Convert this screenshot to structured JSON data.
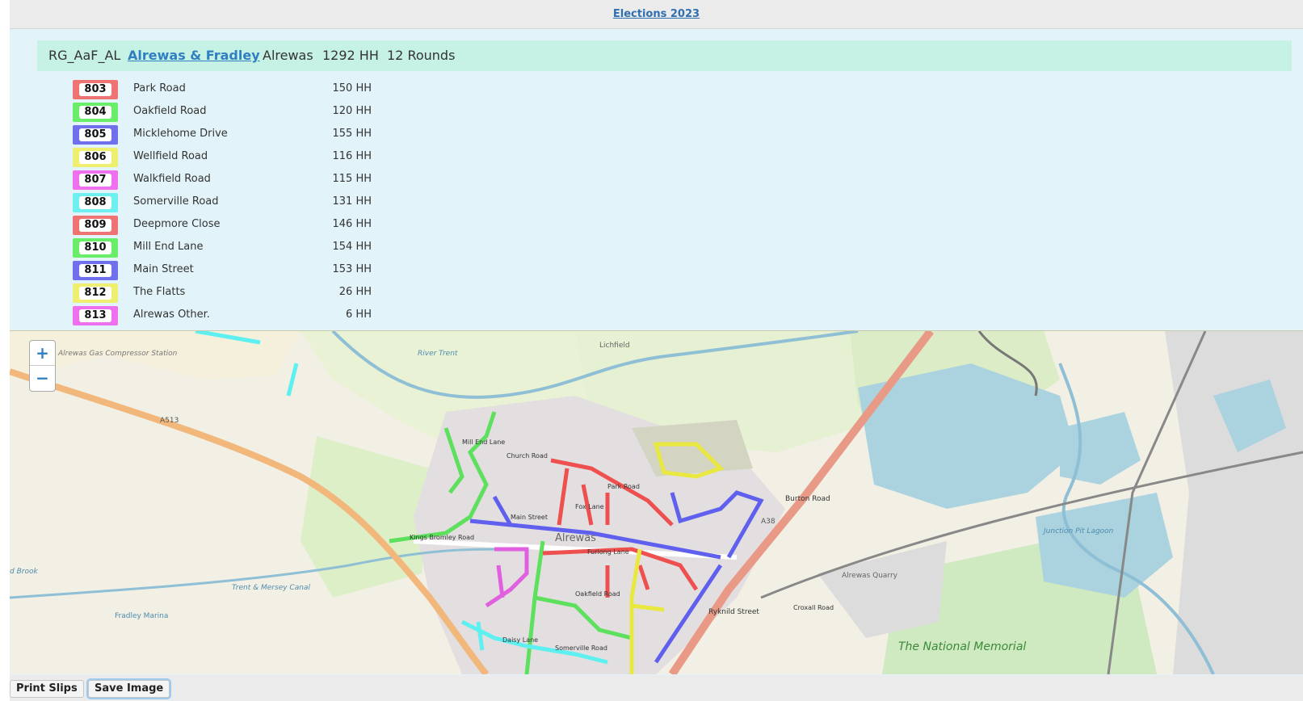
{
  "app": {
    "title_link": "Elections 2023"
  },
  "header": {
    "code": "RG_AaF_AL",
    "ward_link": "Alrewas & Fradley",
    "place": "Alrewas",
    "households": "1292 HH",
    "rounds": "12 Rounds"
  },
  "rounds": [
    {
      "number": "803",
      "street": "Park Road",
      "hh": "150 HH",
      "color": "#f07373"
    },
    {
      "number": "804",
      "street": "Oakfield Road",
      "hh": "120 HH",
      "color": "#6aee6a"
    },
    {
      "number": "805",
      "street": "Micklehome Drive",
      "hh": "155 HH",
      "color": "#7070ee"
    },
    {
      "number": "806",
      "street": "Wellfield Road",
      "hh": "116 HH",
      "color": "#efef6f"
    },
    {
      "number": "807",
      "street": "Walkfield Road",
      "hh": "115 HH",
      "color": "#ee70ee"
    },
    {
      "number": "808",
      "street": "Somerville Road",
      "hh": "131 HH",
      "color": "#6ff0f0"
    },
    {
      "number": "809",
      "street": "Deepmore Close",
      "hh": "146 HH",
      "color": "#f07373"
    },
    {
      "number": "810",
      "street": "Mill End Lane",
      "hh": "154 HH",
      "color": "#6aee6a"
    },
    {
      "number": "811",
      "street": "Main Street",
      "hh": "153 HH",
      "color": "#7070ee"
    },
    {
      "number": "812",
      "street": "The Flatts",
      "hh": "26 HH",
      "color": "#efef6f"
    },
    {
      "number": "813",
      "street": "Alrewas Other.",
      "hh": "6 HH",
      "color": "#ee70ee"
    }
  ],
  "map": {
    "zoom_in": "+",
    "zoom_out": "−",
    "labels": {
      "alrewas": "Alrewas",
      "gas_station": "Alrewas Gas Compressor Station",
      "a513": "A513",
      "a38": "A38",
      "church_road": "Church Road",
      "main_street": "Main Street",
      "park_road": "Park Road",
      "fox_lane": "Fox Lane",
      "mill_end_lane": "Mill End Lane",
      "kings_bromley_road": "Kings Bromley Road",
      "furlong_lane": "Furlong Lane",
      "oakfield_road": "Oakfield Road",
      "somerville_road": "Somerville Road",
      "daisy_lane": "Daisy Lane",
      "trent_mersey": "Trent & Mersey Canal",
      "fradley_marina": "Fradley Marina",
      "river_trent": "River Trent",
      "burton_road": "Burton Road",
      "ryknild_street": "Ryknild Street",
      "croxall_road": "Croxall Road",
      "alrewas_quarry": "Alrewas Quarry",
      "junction_pit_lagoon": "Junction Pit Lagoon",
      "national_memorial": "The National Memorial",
      "lichfield": "Lichfield",
      "brook": "d Brook"
    }
  },
  "buttons": {
    "print": "Print Slips",
    "save": "Save Image"
  }
}
